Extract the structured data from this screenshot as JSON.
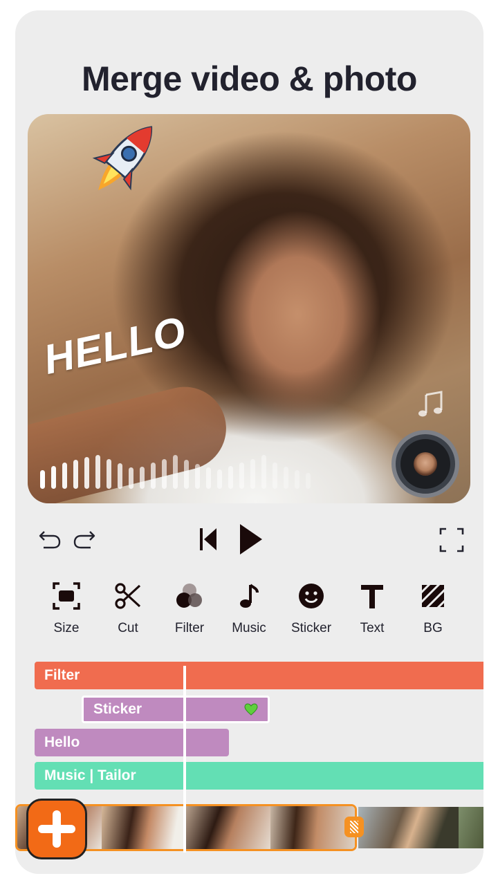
{
  "title": "Merge video & photo",
  "preview": {
    "overlay_text": "HELLO",
    "sticker": "rocket-sticker",
    "music_icon": "music-note-icon",
    "waveform_levels": [
      0.5,
      0.62,
      0.7,
      0.78,
      0.85,
      0.9,
      0.8,
      0.68,
      0.58,
      0.6,
      0.7,
      0.8,
      0.9,
      0.78,
      0.66,
      0.58,
      0.52,
      0.62,
      0.7,
      0.8,
      0.9,
      0.7,
      0.6,
      0.5,
      0.42
    ]
  },
  "controls": {
    "undo": "undo-icon",
    "redo": "redo-icon",
    "previous": "skip-previous-icon",
    "play": "play-icon",
    "fullscreen": "fullscreen-icon"
  },
  "tools": [
    {
      "label": "Size",
      "icon": "size-icon"
    },
    {
      "label": "Cut",
      "icon": "scissors-icon"
    },
    {
      "label": "Filter",
      "icon": "filter-icon"
    },
    {
      "label": "Music",
      "icon": "music-icon"
    },
    {
      "label": "Sticker",
      "icon": "smiley-icon"
    },
    {
      "label": "Text",
      "icon": "text-icon"
    },
    {
      "label": "BG",
      "icon": "background-icon"
    }
  ],
  "timeline": {
    "tracks": [
      {
        "label": "Filter",
        "color": "#f06c4f"
      },
      {
        "label": "Sticker",
        "color": "#bf8abf",
        "emoji": "green-heart"
      },
      {
        "label": "Hello",
        "color": "#bf8abf"
      },
      {
        "label": "Music | Tailor",
        "color": "#63dfb4"
      }
    ],
    "selection_color": "#f59122",
    "add_button": "add-clip-icon"
  }
}
